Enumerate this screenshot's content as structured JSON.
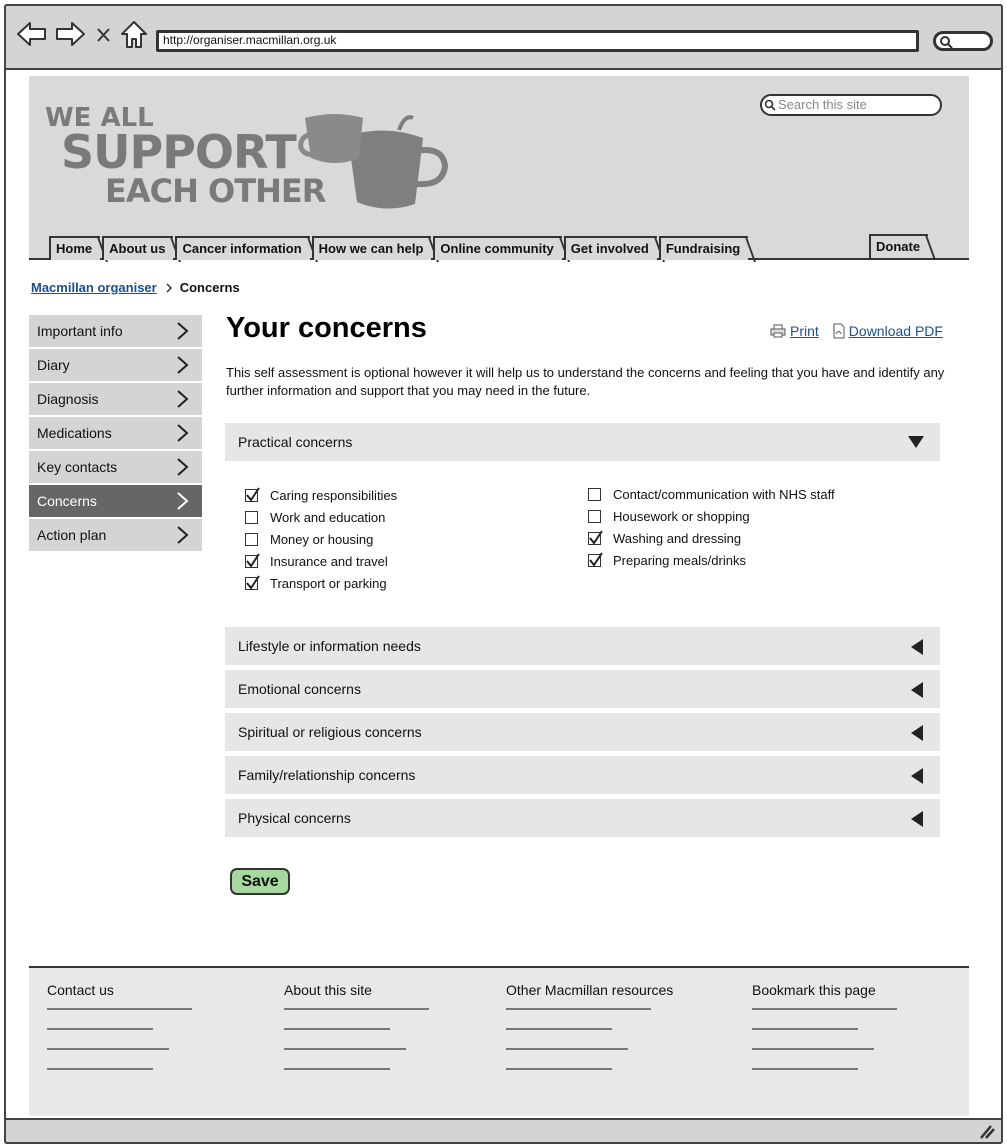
{
  "browser": {
    "url": "http://organiser.macmillan.org.uk"
  },
  "header": {
    "logo_lines": [
      "WE ALL",
      "SUPPORT",
      "EACH OTHER"
    ],
    "search_placeholder": "Search this site",
    "nav": [
      "Home",
      "About us",
      "Cancer information",
      "How we can help",
      "Online community",
      "Get involved",
      "Fundraising"
    ],
    "donate": "Donate"
  },
  "breadcrumb": {
    "parent": "Macmillan organiser",
    "current": "Concerns"
  },
  "sidebar": {
    "items": [
      {
        "label": "Important info"
      },
      {
        "label": "Diary"
      },
      {
        "label": "Diagnosis"
      },
      {
        "label": "Medications"
      },
      {
        "label": "Key contacts"
      },
      {
        "label": "Concerns"
      },
      {
        "label": "Action plan"
      }
    ],
    "active": "Concerns"
  },
  "main": {
    "title": "Your concerns",
    "print": "Print",
    "download": "Download PDF",
    "intro": "This self assessment is optional however it will help us to understand the concerns and feeling that you have and identify any further information and support that you may need in the future.",
    "sections": [
      {
        "label": "Practical concerns",
        "expanded": true
      },
      {
        "label": "Lifestyle or information needs",
        "expanded": false
      },
      {
        "label": "Emotional concerns",
        "expanded": false
      },
      {
        "label": "Spiritual or religious concerns",
        "expanded": false
      },
      {
        "label": "Family/relationship concerns",
        "expanded": false
      },
      {
        "label": "Physical concerns",
        "expanded": false
      }
    ],
    "practical_left": [
      {
        "label": "Caring responsibilities",
        "checked": true
      },
      {
        "label": "Work and education",
        "checked": false
      },
      {
        "label": "Money or housing",
        "checked": false
      },
      {
        "label": "Insurance and travel",
        "checked": true
      },
      {
        "label": "Transport or parking",
        "checked": true
      }
    ],
    "practical_right": [
      {
        "label": "Contact/communication with NHS staff",
        "checked": false
      },
      {
        "label": "Housework or shopping",
        "checked": false
      },
      {
        "label": "Washing and dressing",
        "checked": true
      },
      {
        "label": "Preparing meals/drinks",
        "checked": true
      }
    ],
    "save": "Save"
  },
  "footer": {
    "columns": [
      "Contact us",
      "About this site",
      "Other Macmillan resources",
      "Bookmark this page"
    ]
  }
}
